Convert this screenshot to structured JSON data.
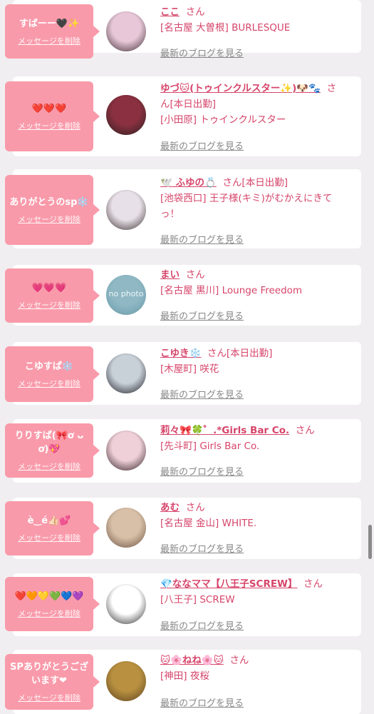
{
  "entries": [
    {
      "message": "すばーー🖤✨",
      "delete_label": "メッセージを削除",
      "name": "ここ",
      "san": "さん",
      "tail": "",
      "shop": "[名古屋 大曽根] BURLESQUE",
      "blog": "最新のブログを見る",
      "avatar_colors": [
        "#e8c8d8",
        "#3a2a30"
      ]
    },
    {
      "message": "❤️❤️❤️",
      "delete_label": "メッセージを削除",
      "name": "ゆづ🐱(トゥインクルスター✨)🐶🐾",
      "san": "さん",
      "tail": "[本日出勤]",
      "shop": "[小田原] トゥインクルスター",
      "blog": "最新のブログを見る",
      "avatar_colors": [
        "#8a3040",
        "#2a2020"
      ]
    },
    {
      "message": "ありがとうのsp❄️",
      "delete_label": "メッセージを削除",
      "name": "🕊️ ふゆの💍",
      "san": "さん",
      "tail": "[本日出勤]",
      "shop": "[池袋西口] 王子様(キミ)がむかえにきてっ！",
      "blog": "最新のブログを見る",
      "avatar_colors": [
        "#e8e0e8",
        "#3a3030"
      ]
    },
    {
      "message": "💗💗💗",
      "delete_label": "メッセージを削除",
      "name": "まい",
      "san": "さん",
      "tail": "",
      "shop": "[名古屋 黒川] Lounge Freedom",
      "blog": "最新のブログを見る",
      "avatar_colors": [
        "#8fb8c4",
        "#6a98a8"
      ],
      "avatar_text": "no photo"
    },
    {
      "message": "こゆすぱ❄️",
      "delete_label": "メッセージを削除",
      "name": "こゆき❄️",
      "san": "さん",
      "tail": "[本日出勤]",
      "shop": "[木屋町] 咲花",
      "blog": "最新のブログを見る",
      "avatar_colors": [
        "#c8d0d8",
        "#1a1a20"
      ]
    },
    {
      "message": "りりすぱ(🎀ơ ᴗ ơ)💖",
      "delete_label": "メッセージを削除",
      "name": "莉々🎀🍀゜.*Girls Bar Co.",
      "san": "さん",
      "tail": "",
      "shop": "[先斗町] Girls Bar Co.",
      "blog": "最新のブログを見る",
      "avatar_colors": [
        "#f0d0d8",
        "#2a1a20"
      ]
    },
    {
      "message": "è‿é👍🏻💕",
      "delete_label": "メッセージを削除",
      "name": "あむ",
      "san": "さん",
      "tail": "",
      "shop": "[名古屋 金山] WHITE.",
      "blog": "最新のブログを見る",
      "avatar_colors": [
        "#d8c0a8",
        "#6a5040"
      ]
    },
    {
      "message": "❤️🧡💛💚💙💜",
      "delete_label": "メッセージを削除",
      "name": "💎ななママ【八王子SCREW】",
      "san": "さん",
      "tail": "",
      "shop": "[八王子] SCREW",
      "blog": "最新のブログを見る",
      "avatar_colors": [
        "#ffffff",
        "#2a2a2a"
      ]
    },
    {
      "message": "SPありがとうございます❤︎",
      "delete_label": "メッセージを削除",
      "name": "🐱🌸ねね🌸🐱",
      "san": "さん",
      "tail": "",
      "shop": "[神田] 夜桜",
      "blog": "最新のブログを見る",
      "avatar_colors": [
        "#b89040",
        "#5a4020"
      ]
    }
  ]
}
